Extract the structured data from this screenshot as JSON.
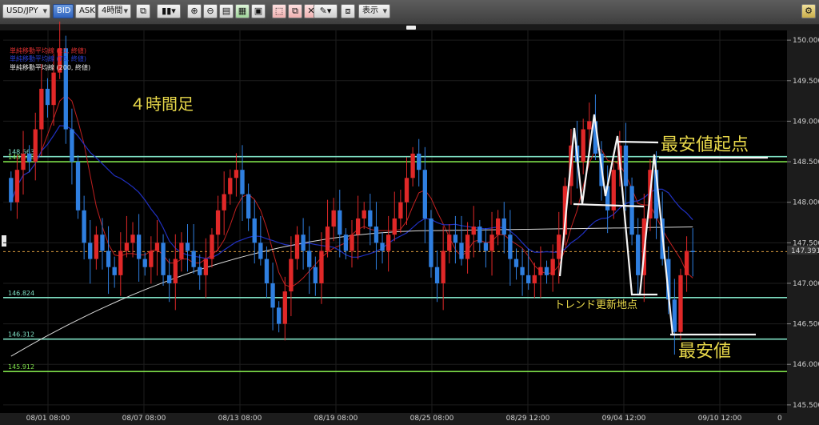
{
  "toolbar": {
    "symbol": "USD/JPY",
    "bid_label": "BID",
    "ask_label": "ASK",
    "timeframe": "4時間",
    "display_label": "表示"
  },
  "legend": [
    {
      "text": "単純移動平均線 (21, 終値)",
      "color": "#e03030"
    },
    {
      "text": "単純移動平均線 (75, 終値)",
      "color": "#2a3fd0"
    },
    {
      "text": "単純移動平均線 (200, 終値)",
      "color": "#e8e8e8"
    }
  ],
  "annotations": {
    "timeframe_note": "４時間足",
    "lowest_origin": "最安値起点",
    "trend_update": "トレンド更新地点",
    "lowest": "最安値"
  },
  "chart_data": {
    "type": "candlestick",
    "pair": "USD/JPY",
    "timeframe": "4時間",
    "price_side": "BID",
    "y_ticks": [
      "150.000",
      "149.500",
      "149.000",
      "148.500",
      "148.000",
      "147.500",
      "147.000",
      "146.500",
      "146.000",
      "145.500"
    ],
    "ylim": [
      145.4,
      150.12
    ],
    "x_ticks": [
      "08/01 08:00",
      "08/07 08:00",
      "08/13 08:00",
      "08/19 08:00",
      "08/25 08:00",
      "08/29 12:00",
      "09/04 12:00",
      "09/10 12:00"
    ],
    "current_price": "147.391",
    "horizontal_lines": [
      {
        "label": "148.563",
        "price": 148.563,
        "color": "#7fe0c4"
      },
      {
        "label": "148.500",
        "price": 148.5,
        "color": "#7ee04a"
      },
      {
        "label": "146.824",
        "price": 146.824,
        "color": "#7fe0c4"
      },
      {
        "label": "146.312",
        "price": 146.312,
        "color": "#7fe0c4"
      },
      {
        "label": "145.912",
        "price": 145.912,
        "color": "#7ee04a"
      }
    ],
    "colors": {
      "up": "#e02828",
      "down": "#2f7fe0",
      "ma21": "#c02020",
      "ma75": "#2030c0",
      "ma200": "#d8d8d8",
      "current": "#e0a040"
    },
    "closes": [
      148.0,
      148.4,
      148.6,
      148.5,
      148.9,
      149.4,
      149.2,
      149.6,
      149.9,
      148.9,
      148.5,
      147.9,
      147.5,
      147.3,
      147.6,
      147.4,
      147.2,
      147.1,
      147.4,
      147.5,
      147.6,
      147.3,
      147.2,
      147.4,
      147.5,
      147.1,
      147.0,
      147.3,
      147.5,
      147.4,
      147.2,
      147.1,
      147.3,
      147.6,
      147.9,
      148.1,
      148.3,
      148.4,
      148.1,
      147.8,
      147.5,
      147.3,
      147.0,
      146.7,
      146.5,
      146.9,
      147.3,
      147.6,
      147.4,
      147.2,
      147.0,
      147.4,
      147.7,
      147.9,
      147.6,
      147.4,
      147.6,
      147.8,
      147.9,
      147.7,
      147.5,
      147.4,
      147.6,
      147.8,
      148.0,
      148.3,
      148.6,
      148.4,
      147.8,
      147.2,
      147.0,
      147.4,
      147.6,
      147.5,
      147.3,
      147.6,
      147.7,
      147.5,
      147.4,
      147.6,
      147.8,
      147.6,
      147.3,
      147.2,
      147.1,
      147.0,
      147.1,
      147.2,
      147.1,
      147.3,
      147.6,
      148.2,
      148.7,
      148.5,
      148.9,
      149.0,
      148.6,
      148.2,
      147.9,
      148.4,
      148.7,
      148.2,
      147.6,
      147.1,
      147.8,
      148.4,
      147.8,
      147.3,
      146.8,
      146.4,
      147.1,
      147.4,
      147.39
    ]
  }
}
